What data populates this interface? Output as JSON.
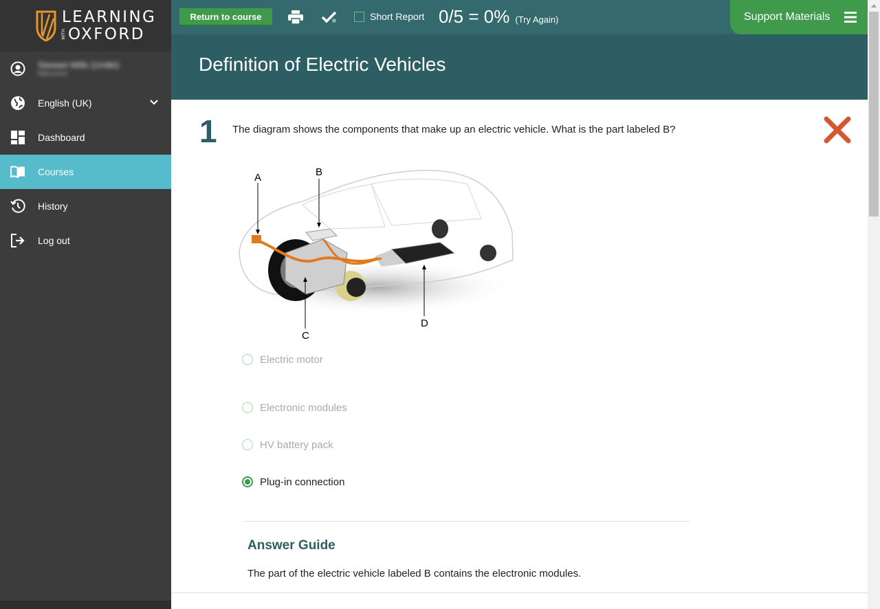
{
  "brand": {
    "line1": "LEARNING",
    "with": "WITH",
    "line2": "OXFORD"
  },
  "sidebar": {
    "user": {
      "name": "Stewart Mills (Unitki)",
      "sub": "tlafcourse"
    },
    "language": "English (UK)",
    "items": [
      {
        "label": "Dashboard",
        "icon": "dashboard-icon"
      },
      {
        "label": "Courses",
        "icon": "book-icon",
        "active": true
      },
      {
        "label": "History",
        "icon": "history-icon"
      },
      {
        "label": "Log out",
        "icon": "logout-icon"
      }
    ]
  },
  "toolbar": {
    "return_label": "Return to course",
    "short_report_label": "Short Report",
    "score": "0/5 = 0%",
    "try_again": "(Try Again)",
    "support_label": "Support Materials"
  },
  "page": {
    "title": "Definition of Electric Vehicles"
  },
  "question": {
    "number": "1",
    "text": "The diagram shows the components that make up an electric vehicle. What is the part labeled B?",
    "result": "incorrect",
    "diagram_labels": [
      "A",
      "B",
      "C",
      "D"
    ],
    "options": [
      {
        "label": "Electric motor",
        "selected": false
      },
      {
        "label": "Electronic modules",
        "selected": false
      },
      {
        "label": "HV battery pack",
        "selected": false
      },
      {
        "label": "Plug-in connection",
        "selected": true
      }
    ]
  },
  "answer_guide": {
    "title": "Answer Guide",
    "text": "The part of the electric vehicle labeled B contains the electronic modules."
  },
  "colors": {
    "sidebar_bg": "#3c3c3c",
    "active_item": "#56bccb",
    "topbar": "#346a6e",
    "titlebar": "#2d5e64",
    "green": "#3f9b4b",
    "wrong_mark": "#d4582f"
  }
}
